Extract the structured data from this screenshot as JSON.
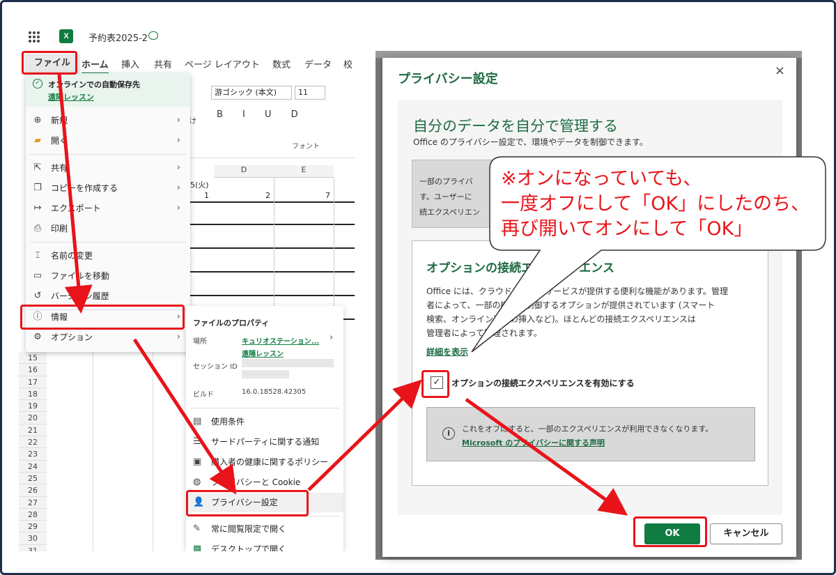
{
  "excel": {
    "doc_title": "予約表2025-2",
    "tabs": [
      "ファイル",
      "ホーム",
      "挿入",
      "共有",
      "ページ レイアウト",
      "数式",
      "データ",
      "校"
    ],
    "ribbon": {
      "font_name": "游ゴシック (本文)",
      "font_size": "11",
      "group_label": "フォント",
      "fragment": "け",
      "styles": "B I U D"
    },
    "sheet": {
      "col_headers": [
        "D",
        "E"
      ],
      "date_cell": "5(火)",
      "row1_values": [
        "1",
        "2",
        "7"
      ],
      "row_numbers": [
        "15",
        "16",
        "17",
        "18",
        "19",
        "20",
        "21",
        "22",
        "23",
        "24",
        "25",
        "26",
        "27",
        "28",
        "29",
        "30",
        "31"
      ]
    },
    "file_menu": {
      "autosave_title": "オンラインでの自動保存先",
      "autosave_link": "遠隔レッスン",
      "items": [
        {
          "label": "新規",
          "icon": "plus-icon"
        },
        {
          "label": "開く",
          "icon": "folder-icon"
        },
        {
          "label": "共有",
          "icon": "share-icon"
        },
        {
          "label": "コピーを作成する",
          "icon": "copy-icon"
        },
        {
          "label": "エクスポート",
          "icon": "export-icon"
        },
        {
          "label": "印刷",
          "icon": "print-icon"
        },
        {
          "label": "名前の変更",
          "icon": "rename-icon"
        },
        {
          "label": "ファイルを移動",
          "icon": "move-file-icon"
        },
        {
          "label": "バージョン履歴",
          "icon": "history-icon"
        },
        {
          "label": "情報",
          "icon": "info-icon"
        },
        {
          "label": "オプション",
          "icon": "options-icon"
        }
      ]
    },
    "info_pane": {
      "heading": "ファイルのプロパティ",
      "location_label": "場所",
      "location_value": "キュリオステーション...",
      "location_sub": "遠隔レッスン",
      "session_label": "セッション ID",
      "build_label": "ビルド",
      "build_value": "16.0.18528.42305",
      "items": [
        {
          "label": "使用条件",
          "icon": "document-icon"
        },
        {
          "label": "サードパーティに関する通知",
          "icon": "list-icon"
        },
        {
          "label": "購入者の健康に関するポリシー",
          "icon": "health-icon"
        },
        {
          "label": "プライバシーと Cookie",
          "icon": "cookie-icon"
        },
        {
          "label": "プライバシー設定",
          "icon": "privacy-icon"
        },
        {
          "label": "常に閲覧限定で開く",
          "icon": "pen-off-icon"
        },
        {
          "label": "デスクトップで開く",
          "icon": "excel-icon"
        }
      ]
    }
  },
  "dialog": {
    "title": "プライバシー設定",
    "close": "×",
    "heading": "自分のデータを自分で管理する",
    "subheading": "Office のプライバシー設定で、環境やデータを制御できます。",
    "partial_box_lines": [
      "一部のプライバ",
      "す。ユーザーに",
      "続エクスペリエン"
    ],
    "options_heading": "オプションの接続エクスペリエンス",
    "options_body": [
      "Office には、クラウドベースのサービスが提供する便利な機能があります。管理",
      "者によって、一部の機能を制御するオプションが提供されています (スマート",
      "検索、オンライン画像の挿入など)。ほとんどの接続エクスペリエンスは",
      "管理者によって管理されます。"
    ],
    "details_link": "詳細を表示",
    "checkbox_label": "オプションの接続エクスペリエンスを有効にする",
    "checkbox_checked": true,
    "warning_text": "これをオフにすると、一部のエクスペリエンスが利用できなくなります。",
    "warning_link": "Microsoft のプライバシーに関する声明",
    "ok": "OK",
    "cancel": "キャンセル"
  },
  "callout": {
    "lines": [
      "※オンになっていても、",
      "一度オフにして「OK」にしたのち、",
      "再び開いてオンにして「OK」"
    ],
    "color": "#e8141a"
  },
  "colors": {
    "excel_green": "#107c41",
    "dialog_green": "#1e6b42",
    "annotation_red": "#e8141a"
  }
}
